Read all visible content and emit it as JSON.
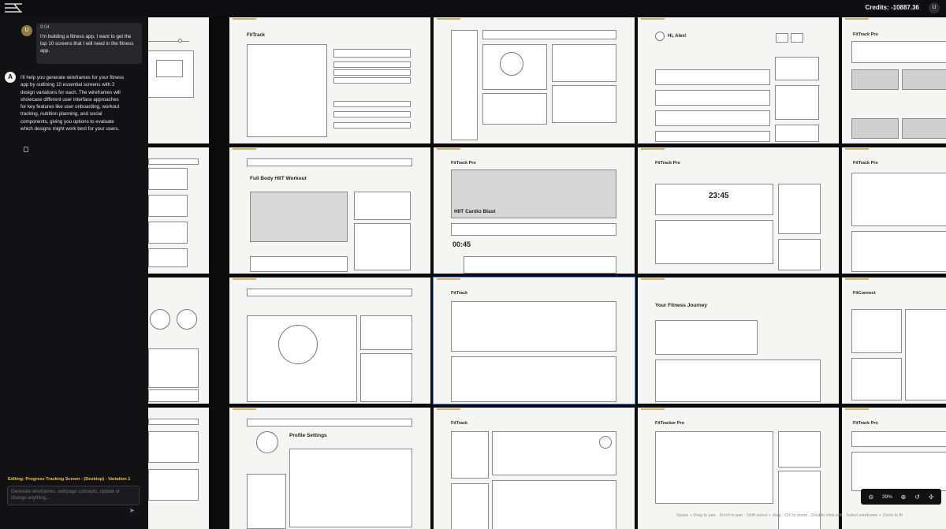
{
  "header": {
    "credits": "Credits: -10887.36",
    "user_initial": "U"
  },
  "chat": {
    "user_message": {
      "initial": "U",
      "time": "9:04",
      "text": "I'm building a fitness app, I want to get the top 10 screens that I will need in the fitness app."
    },
    "assistant_message": {
      "initial": "A",
      "text": "I'll help you generate wireframes for your fitness app by outlining 10 essential screens with 2 design variations for each. The wireframes will showcase different user interface approaches for key features like user onboarding, workout tracking, nutrition planning, and social components, giving you options to evaluate which designs might work best for your users."
    },
    "editing_label": "Editing: Progress Tracking Screen - (Desktop) - Variation 1",
    "input_placeholder": "Generate wireframes, webpage concepts, update or change anything..."
  },
  "canvas": {
    "titles": {
      "r0c1": "FitTrack",
      "r0c4": "Hi, Alex!",
      "r0c5": "FitTrack Pro",
      "r1c1": "Full Body HIIT Workout",
      "r1c2": "FitTrack Pro",
      "r1c2_name": "HIIT Cardio Blast",
      "r1c2_timer": "00:45",
      "r1c3": "FitTrack Pro",
      "r1c3_timer": "23:45",
      "r1c4": "FitTrack Pro",
      "r2c2": "FitTrack",
      "r2c3": "Your Fitness Journey",
      "r2c4": "FitConnect",
      "r3c1": "Profile Settings",
      "r3c2": "FitTrack",
      "r3c3": "FitTracker Pro",
      "r3c4": "FitTrack Pro"
    }
  },
  "toolbar": {
    "zoom": "39%"
  },
  "hint": "Space + Drag to pan · Scroll to pan · Shift select + drag · Ctrl to zoom · Double click edit · Select wireframe + Zoom to fit"
}
